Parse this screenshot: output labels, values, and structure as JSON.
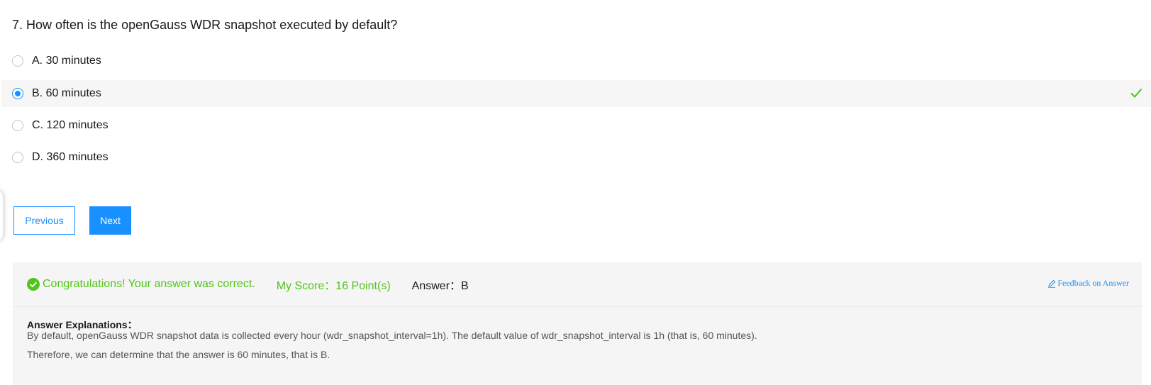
{
  "question": {
    "text": "7. How often is the openGauss WDR snapshot executed by default?"
  },
  "options": [
    {
      "label": "A. 30 minutes",
      "selected": false
    },
    {
      "label": "B. 60 minutes",
      "selected": true,
      "correct": true
    },
    {
      "label": "C. 120 minutes",
      "selected": false
    },
    {
      "label": "D. 360 minutes",
      "selected": false
    }
  ],
  "nav": {
    "previous_label": "Previous",
    "next_label": "Next"
  },
  "result": {
    "message": "Congratulations! Your answer was correct.",
    "score": "My Score：16 Point(s)",
    "answer": "Answer：B",
    "feedback_label": "Feedback on Answer"
  },
  "explanation": {
    "title": "Answer Explanations：",
    "lines": [
      "By default, openGauss WDR snapshot data is collected every hour (wdr_snapshot_interval=1h). The default value of wdr_snapshot_interval is 1h (that is, 60 minutes).",
      "Therefore, we can determine that the answer is 60 minutes, that is B."
    ]
  },
  "colors": {
    "accent": "#1890ff",
    "success": "#52c41a",
    "panel_bg": "#f5f5f5"
  },
  "icons": {
    "correct_mark": "checkmark-icon",
    "result": "check-circle-icon",
    "feedback": "edit-icon"
  }
}
